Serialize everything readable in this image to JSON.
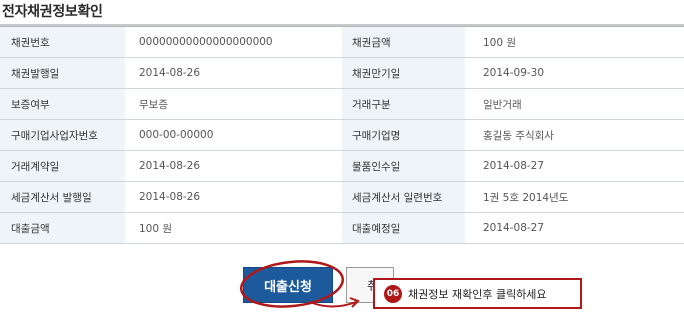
{
  "page": {
    "title": "전자채권정보확인"
  },
  "table": {
    "rows": [
      {
        "label1": "채권번호",
        "value1": "00000000000000000000",
        "label2": "채권금액",
        "value2": "100 원"
      },
      {
        "label1": "채권발행일",
        "value1": "2014-08-26",
        "label2": "채권만기일",
        "value2": "2014-09-30"
      },
      {
        "label1": "보증여부",
        "value1": "무보증",
        "label2": "거래구분",
        "value2": "일반거래"
      },
      {
        "label1": "구매기업사업자번호",
        "value1": "000-00-00000",
        "label2": "구매기업명",
        "value2": "홍길동 주식회사"
      },
      {
        "label1": "거래계약일",
        "value1": "2014-08-26",
        "label2": "물품인수일",
        "value2": "2014-08-27"
      },
      {
        "label1": "세금계산서 발행일",
        "value1": "2014-08-26",
        "label2": "세금계산서 일련번호",
        "value2": "1권 5호 2014년도"
      },
      {
        "label1": "대출금액",
        "value1": "100 원",
        "label2": "대출예정일",
        "value2": "2014-08-27"
      }
    ]
  },
  "buttons": {
    "loan_apply": "대출신청",
    "cancel": "취"
  },
  "callout": {
    "step": "06",
    "text": "채권정보 재확인후 클릭하세요"
  },
  "colors": {
    "accent_blue": "#1d5a9c",
    "annotation_red": "#b01818",
    "label_bg": "#eef4f8"
  }
}
